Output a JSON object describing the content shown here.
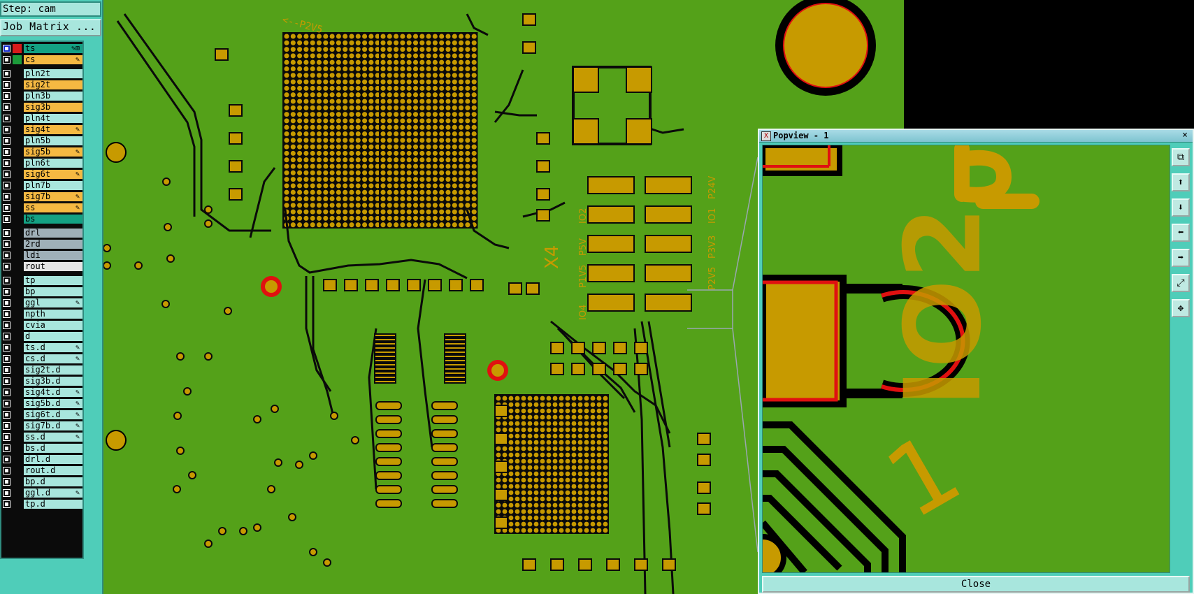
{
  "step": {
    "label": "Step: cam"
  },
  "job_matrix_button": "Job Matrix ...",
  "layers": [
    {
      "name": "ts",
      "color": "#14a183",
      "swatch": "#d81b1b",
      "checkbox": "blue",
      "flag": "✎⊞"
    },
    {
      "name": "cs",
      "color": "#f5b942",
      "swatch": "#1c9b3a",
      "checkbox": "normal",
      "flag": "✎"
    },
    {
      "name": "pln2t",
      "color": "#a8e6dd",
      "swatch": "",
      "checkbox": "normal",
      "flag": ""
    },
    {
      "name": "sig2t",
      "color": "#f5b942",
      "swatch": "",
      "checkbox": "normal",
      "flag": ""
    },
    {
      "name": "pln3b",
      "color": "#a8e6dd",
      "swatch": "",
      "checkbox": "normal",
      "flag": ""
    },
    {
      "name": "sig3b",
      "color": "#f5b942",
      "swatch": "",
      "checkbox": "normal",
      "flag": ""
    },
    {
      "name": "pln4t",
      "color": "#a8e6dd",
      "swatch": "",
      "checkbox": "normal",
      "flag": ""
    },
    {
      "name": "sig4t",
      "color": "#f5b942",
      "swatch": "",
      "checkbox": "normal",
      "flag": "✎"
    },
    {
      "name": "pln5b",
      "color": "#a8e6dd",
      "swatch": "",
      "checkbox": "normal",
      "flag": ""
    },
    {
      "name": "sig5b",
      "color": "#f5b942",
      "swatch": "",
      "checkbox": "normal",
      "flag": "✎"
    },
    {
      "name": "pln6t",
      "color": "#a8e6dd",
      "swatch": "",
      "checkbox": "normal",
      "flag": ""
    },
    {
      "name": "sig6t",
      "color": "#f5b942",
      "swatch": "",
      "checkbox": "normal",
      "flag": "✎"
    },
    {
      "name": "pln7b",
      "color": "#a8e6dd",
      "swatch": "",
      "checkbox": "normal",
      "flag": ""
    },
    {
      "name": "sig7b",
      "color": "#f5b942",
      "swatch": "",
      "checkbox": "normal",
      "flag": "✎"
    },
    {
      "name": "ss",
      "color": "#f5b942",
      "swatch": "",
      "checkbox": "normal",
      "flag": "✎"
    },
    {
      "name": "bs",
      "color": "#14a183",
      "swatch": "",
      "checkbox": "normal",
      "flag": ""
    },
    {
      "name": "drl",
      "color": "#9fb0b8",
      "swatch": "",
      "checkbox": "normal",
      "flag": ""
    },
    {
      "name": "2rd",
      "color": "#9fb0b8",
      "swatch": "",
      "checkbox": "normal",
      "flag": ""
    },
    {
      "name": "ldi",
      "color": "#9fb0b8",
      "swatch": "",
      "checkbox": "normal",
      "flag": ""
    },
    {
      "name": "rout",
      "color": "#e5e5e5",
      "swatch": "",
      "checkbox": "normal",
      "flag": ""
    },
    {
      "name": "tp",
      "color": "#a8e6dd",
      "swatch": "",
      "checkbox": "normal",
      "flag": ""
    },
    {
      "name": "bp",
      "color": "#a8e6dd",
      "swatch": "",
      "checkbox": "normal",
      "flag": ""
    },
    {
      "name": "ggl",
      "color": "#a8e6dd",
      "swatch": "",
      "checkbox": "normal",
      "flag": "✎"
    },
    {
      "name": "npth",
      "color": "#a8e6dd",
      "swatch": "",
      "checkbox": "normal",
      "flag": ""
    },
    {
      "name": "cvia",
      "color": "#a8e6dd",
      "swatch": "",
      "checkbox": "normal",
      "flag": ""
    },
    {
      "name": "d",
      "color": "#a8e6dd",
      "swatch": "",
      "checkbox": "normal",
      "flag": ""
    },
    {
      "name": "ts.d",
      "color": "#a8e6dd",
      "swatch": "",
      "checkbox": "normal",
      "flag": "✎"
    },
    {
      "name": "cs.d",
      "color": "#a8e6dd",
      "swatch": "",
      "checkbox": "normal",
      "flag": "✎"
    },
    {
      "name": "sig2t.d",
      "color": "#a8e6dd",
      "swatch": "",
      "checkbox": "normal",
      "flag": ""
    },
    {
      "name": "sig3b.d",
      "color": "#a8e6dd",
      "swatch": "",
      "checkbox": "normal",
      "flag": ""
    },
    {
      "name": "sig4t.d",
      "color": "#a8e6dd",
      "swatch": "",
      "checkbox": "normal",
      "flag": "✎"
    },
    {
      "name": "sig5b.d",
      "color": "#a8e6dd",
      "swatch": "",
      "checkbox": "normal",
      "flag": "✎"
    },
    {
      "name": "sig6t.d",
      "color": "#a8e6dd",
      "swatch": "",
      "checkbox": "normal",
      "flag": "✎"
    },
    {
      "name": "sig7b.d",
      "color": "#a8e6dd",
      "swatch": "",
      "checkbox": "normal",
      "flag": "✎"
    },
    {
      "name": "ss.d",
      "color": "#a8e6dd",
      "swatch": "",
      "checkbox": "normal",
      "flag": "✎"
    },
    {
      "name": "bs.d",
      "color": "#a8e6dd",
      "swatch": "",
      "checkbox": "normal",
      "flag": ""
    },
    {
      "name": "drl.d",
      "color": "#a8e6dd",
      "swatch": "",
      "checkbox": "normal",
      "flag": ""
    },
    {
      "name": "rout.d",
      "color": "#a8e6dd",
      "swatch": "",
      "checkbox": "normal",
      "flag": ""
    },
    {
      "name": "bp.d",
      "color": "#a8e6dd",
      "swatch": "",
      "checkbox": "normal",
      "flag": ""
    },
    {
      "name": "ggl.d",
      "color": "#a8e6dd",
      "swatch": "",
      "checkbox": "normal",
      "flag": "✎"
    },
    {
      "name": "tp.d",
      "color": "#a8e6dd",
      "swatch": "",
      "checkbox": "normal",
      "flag": ""
    }
  ],
  "board": {
    "background": "#54a119",
    "copper": "#c79a00",
    "trace": "#0a0a0a",
    "highlight": "#e01010",
    "silk_labels": [
      "<--P2V5",
      "X4",
      "IO2",
      "IO1",
      "IO4",
      "P1V5",
      "P5V",
      "P2V5",
      "P3V3",
      "P24V"
    ]
  },
  "popview": {
    "title": "Popview - 1",
    "sys_icon": "X",
    "close_x": "×",
    "close_button": "Close",
    "zoom_labels": [
      "IO2",
      "1"
    ],
    "tools": [
      "zoom-fit-icon",
      "pan-up-icon",
      "pan-down-icon",
      "pan-left-icon",
      "pan-right-icon",
      "zoom-in-icon",
      "zoom-out-icon"
    ]
  }
}
